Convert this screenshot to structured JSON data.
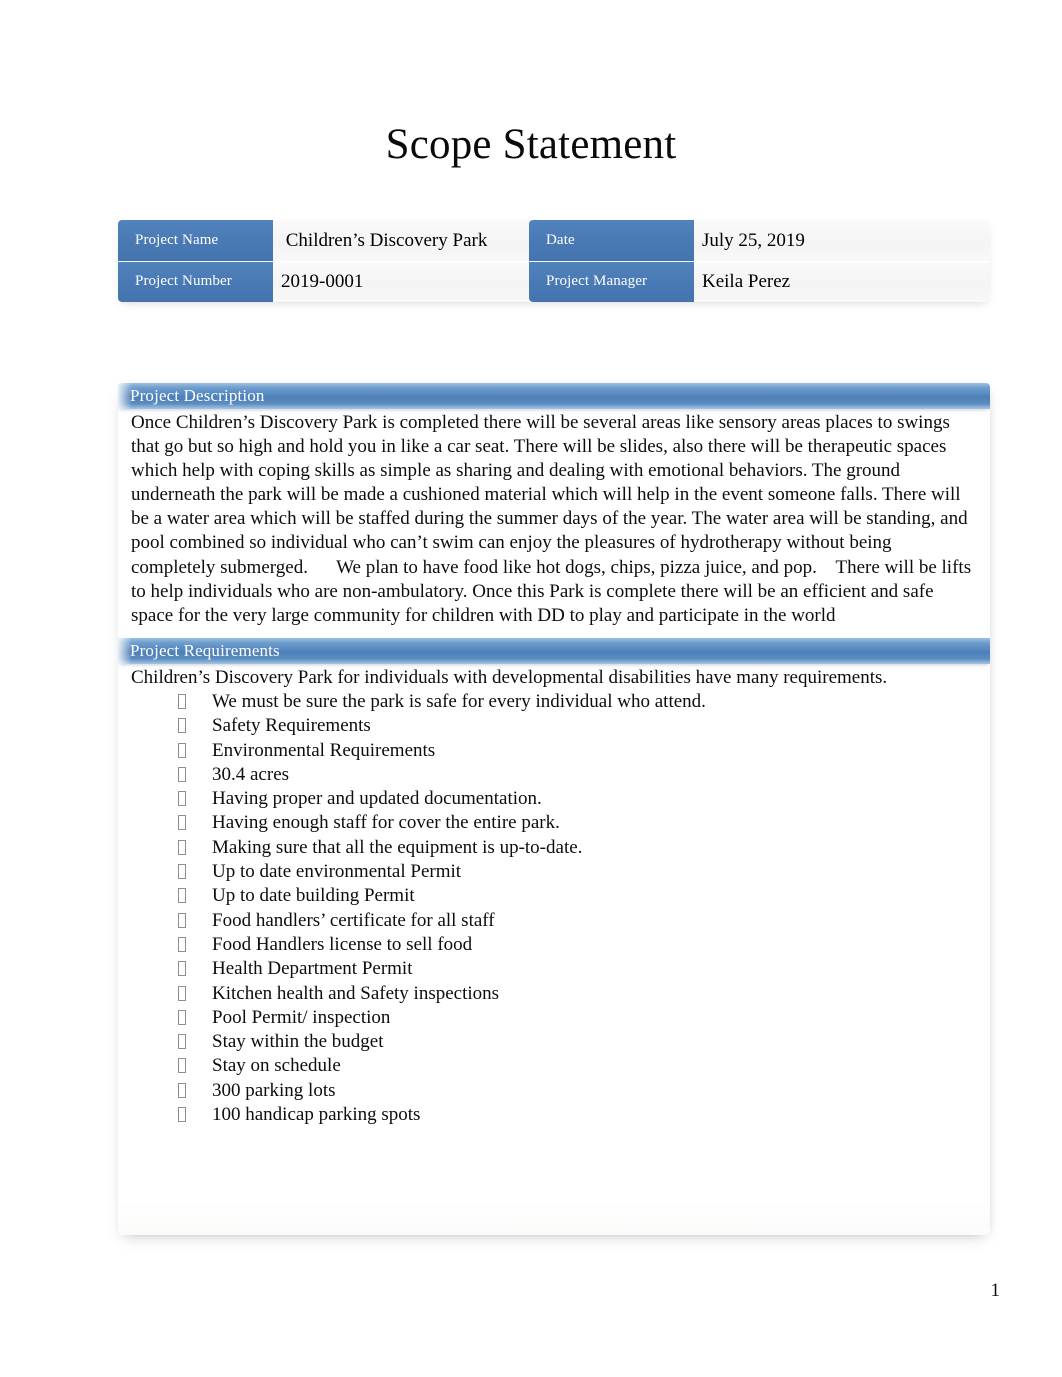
{
  "document": {
    "title": "Scope Statement",
    "page_number": "1",
    "accent_blue": "#4a7ab5",
    "section_bar_blue": "#4c7fb8"
  },
  "info_table": {
    "rows": [
      {
        "label_left": "Project Name",
        "value_left": " Children’s Discovery Park",
        "label_right": "Date",
        "value_right": "July 25, 2019"
      },
      {
        "label_left": "Project Number",
        "value_left": "2019-0001",
        "label_right": "Project Manager",
        "value_right": "Keila Perez"
      }
    ]
  },
  "sections": {
    "description": {
      "heading": "Project Description",
      "body": "Once Children’s Discovery Park is completed there will be several areas like sensory areas places to swings that go but so high and hold you in like a car seat. There will be slides, also there will be therapeutic spaces which help with coping skills as simple as sharing and dealing with emotional behaviors. The ground underneath the park will be made a cushioned material which will help in the event someone falls. There will be a water area which will be staffed during the summer days of the year. The water area will be standing, and pool combined so individual who can’t swim can enjoy the pleasures of hydrotherapy without being completely submerged.      We plan to have food like hot dogs, chips, pizza juice, and pop.    There will be lifts to help individuals who are non-ambulatory. Once this Park is complete there will be an efficient and safe space for the very large community for children with DD to play and participate in the world"
    },
    "requirements": {
      "heading": "Project Requirements",
      "intro": "Children’s Discovery Park for individuals with developmental disabilities have many requirements.",
      "items": [
        "We must be sure the park is safe for every individual who attend.",
        "Safety Requirements",
        "Environmental Requirements",
        "30.4 acres",
        "Having proper and updated documentation.",
        "Having enough staff for cover the entire park.",
        "Making sure that all the equipment is up-to-date.",
        "Up to date environmental Permit",
        "Up to date building Permit",
        "Food handlers’ certificate for all staff",
        "Food Handlers license to sell food",
        "Health Department Permit",
        "Kitchen health and Safety inspections",
        "Pool Permit/ inspection",
        "Stay within the budget",
        "Stay on schedule",
        "300 parking lots",
        "100 handicap parking spots"
      ]
    }
  }
}
